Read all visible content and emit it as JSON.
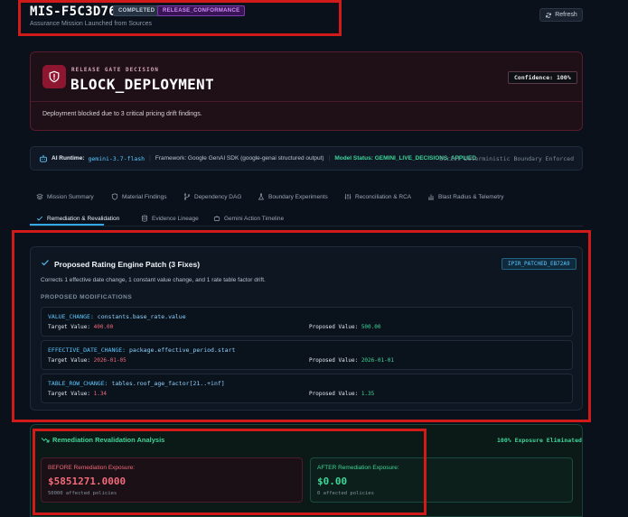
{
  "header": {
    "mission_id": "MIS-F5C3D76E",
    "status_badge": "COMPLETED",
    "type_badge": "RELEASE_CONFORMANCE",
    "subtitle": "Assurance Mission Launched from Sources",
    "refresh_label": "Refresh"
  },
  "decision": {
    "label": "RELEASE GATE DECISION",
    "value": "BLOCK_DEPLOYMENT",
    "confidence": "Confidence: 100%",
    "message": "Deployment blocked due to 3 critical pricing drift findings."
  },
  "runtime": {
    "label": "AI Runtime:",
    "model": "gemini-3.7-flash",
    "framework": "Framework: Google GenAI SDK (google-genai structured output)",
    "status": "Model Status: GEMINI_LIVE_DECISIONS_APPLIED",
    "boundary": "Strict Deterministic Boundary Enforced"
  },
  "tabs": [
    {
      "label": "Mission Summary",
      "icon": "layers-icon"
    },
    {
      "label": "Material Findings",
      "icon": "shield-icon"
    },
    {
      "label": "Dependency DAG",
      "icon": "git-branch-icon"
    },
    {
      "label": "Boundary Experiments",
      "icon": "flask-icon"
    },
    {
      "label": "Reconciliation & RCA",
      "icon": "sliders-icon"
    },
    {
      "label": "Blast Radius & Telemetry",
      "icon": "bar-chart-icon"
    },
    {
      "label": "Remediation & Revalidation",
      "icon": "check-icon",
      "active": true
    },
    {
      "label": "Evidence Lineage",
      "icon": "database-icon"
    },
    {
      "label": "Gemini Action Timeline",
      "icon": "bot-icon"
    }
  ],
  "patch": {
    "title": "Proposed Rating Engine Patch (3 Fixes)",
    "tag": "IPIR_PATCHED_EB72A9",
    "description": "Corrects 1 effective date change, 1 constant value change, and 1 rate table factor drift.",
    "section_label": "PROPOSED MODIFICATIONS",
    "target_label": "Target Value:",
    "proposed_label": "Proposed Value:",
    "modifications": [
      {
        "type": "VALUE_CHANGE:",
        "path": "constants.base_rate.value",
        "target": "400.00",
        "proposed": "500.00"
      },
      {
        "type": "EFFECTIVE_DATE_CHANGE:",
        "path": "package.effective_period.start",
        "target": "2026-01-05",
        "proposed": "2026-01-01"
      },
      {
        "type": "TABLE_ROW_CHANGE:",
        "path": "tables.roof_age_factor[21..+inf]",
        "target": "1.34",
        "proposed": "1.35"
      }
    ]
  },
  "remediation": {
    "title": "Remediation Revalidation Analysis",
    "exposure_eliminated": "100% Exposure Eliminated",
    "before_label": "BEFORE Remediation Exposure:",
    "before_value": "$5851271.0000",
    "before_count": "50000 affected policies",
    "after_label": "AFTER Remediation Exposure:",
    "after_value": "$0.00",
    "after_count": "0 affected policies"
  },
  "colors": {
    "accent_blue": "#5cc8ff",
    "success_green": "#3ed598",
    "danger_red": "#f16a7a",
    "highlight_box": "#d11a1a"
  }
}
